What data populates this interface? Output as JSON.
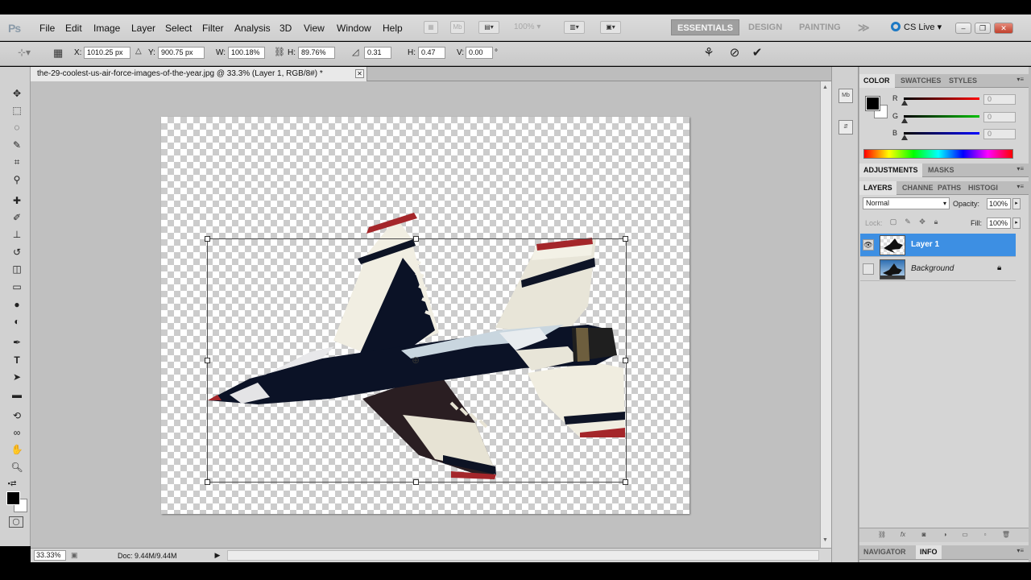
{
  "app": {
    "logo": "Ps"
  },
  "menu": [
    "File",
    "Edit",
    "Image",
    "Layer",
    "Select",
    "Filter",
    "Analysis",
    "3D",
    "View",
    "Window",
    "Help"
  ],
  "menubar": {
    "zoom_percent": "100%",
    "mini_bridge_icon": "Mb",
    "workspaces": [
      "ESSENTIALS",
      "DESIGN",
      "PAINTING"
    ],
    "more_workspaces": "≫",
    "cs_live": "CS Live ▾"
  },
  "options": {
    "x_label": "X:",
    "x_value": "1010.25 px",
    "y_label": "Y:",
    "y_value": "900.75 px",
    "w_label": "W:",
    "w_value": "100.18%",
    "h_label": "H:",
    "h_value": "89.76%",
    "angle_value": "0.31",
    "hskew_label": "H:",
    "hskew_value": "0.47",
    "vskew_label": "V:",
    "vskew_value": "0.00"
  },
  "document": {
    "tab_title": "the-29-coolest-us-air-force-images-of-the-year.jpg @ 33.3% (Layer 1, RGB/8#) *",
    "zoom": "33.33%",
    "doc_size": "Doc: 9.44M/9.44M"
  },
  "color_panel": {
    "tabs": [
      "COLOR",
      "SWATCHES",
      "STYLES"
    ],
    "channels": [
      {
        "label": "R",
        "value": "0",
        "color": "#c80000"
      },
      {
        "label": "G",
        "value": "0",
        "color": "#00a000"
      },
      {
        "label": "B",
        "value": "0",
        "color": "#0000c8"
      }
    ]
  },
  "adjustments_panel": {
    "tabs": [
      "ADJUSTMENTS",
      "MASKS"
    ]
  },
  "layers_panel": {
    "tabs": [
      "LAYERS",
      "CHANNE",
      "PATHS",
      "HISTOGI"
    ],
    "blend_mode": "Normal",
    "opacity_label": "Opacity:",
    "opacity": "100%",
    "lock_label": "Lock:",
    "fill_label": "Fill:",
    "fill": "100%",
    "layers": [
      {
        "name": "Layer 1",
        "visible": true,
        "selected": true
      },
      {
        "name": "Background",
        "visible": false,
        "selected": false,
        "locked": true
      }
    ]
  },
  "bottom_panel": {
    "tabs": [
      "NAVIGATOR",
      "INFO"
    ]
  },
  "colors": {
    "selection_blue": "#3d8fe3",
    "workspace_gray": "#c0c0c0"
  }
}
